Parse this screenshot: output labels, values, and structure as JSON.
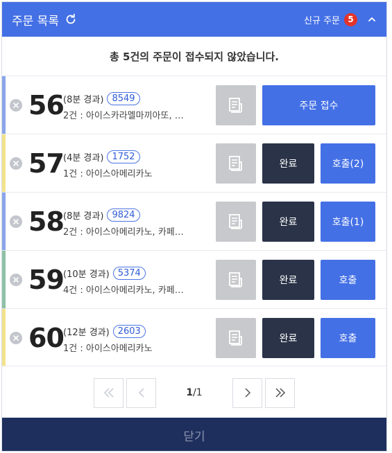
{
  "header": {
    "title": "주문 목록",
    "new_orders_label": "신규 주문",
    "new_orders_count": "5"
  },
  "notice": "총 5건의 주문이 접수되지 않았습니다.",
  "colors": {
    "primary": "#4470e6",
    "dark": "#2a3347",
    "footer": "#1e2f5e",
    "badge": "#e5332a",
    "disabled": "#c8c9cc"
  },
  "orders": [
    {
      "number": "56",
      "elapsed": "(8분 경과)",
      "code": "8549",
      "items": "2건 : 아이스카라멜마끼아또, …",
      "accent": "#8aa6e8",
      "accept_label": "주문 접수"
    },
    {
      "number": "57",
      "elapsed": "(4분 경과)",
      "code": "1752",
      "items": "1건 : 아이스아메리카노",
      "accent": "#f2e38c",
      "complete_label": "완료",
      "call_label": "호출(2)"
    },
    {
      "number": "58",
      "elapsed": "(8분 경과)",
      "code": "9824",
      "items": "2건 : 아이스아메리카노, 카페…",
      "accent": "#8aa6e8",
      "complete_label": "완료",
      "call_label": "호출(1)"
    },
    {
      "number": "59",
      "elapsed": "(10분 경과)",
      "code": "5374",
      "items": "4건 : 아이스아메리카노, 카페…",
      "accent": "#8fc0a6",
      "complete_label": "완료",
      "call_label": "호출"
    },
    {
      "number": "60",
      "elapsed": "(12분 경과)",
      "code": "2603",
      "items": "1건 : 아이스아메리카노",
      "accent": "#f2e38c",
      "complete_label": "완료",
      "call_label": "호출"
    }
  ],
  "pagination": {
    "current": "1",
    "total": "/1"
  },
  "footer": {
    "close_label": "닫기"
  }
}
